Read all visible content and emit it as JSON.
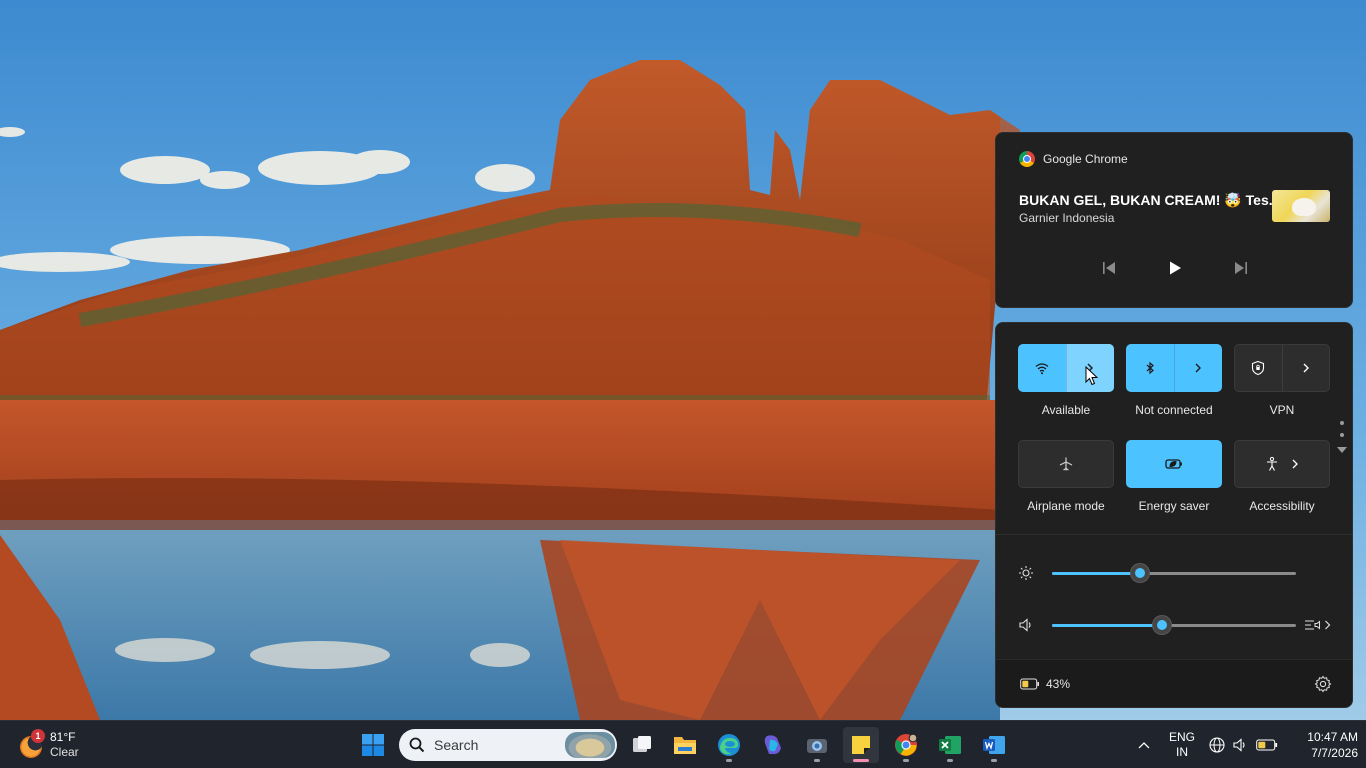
{
  "media": {
    "app_name": "Google Chrome",
    "title": "BUKAN GEL, BUKAN CREAM! 🤯 Tes...",
    "artist": "Garnier Indonesia",
    "controls": {
      "previous": "previous-icon",
      "play": "play-icon",
      "next": "next-icon"
    }
  },
  "quick_settings": {
    "tiles": [
      {
        "id": "wifi",
        "label": "Available",
        "icon": "wifi-icon",
        "state": "on",
        "expandable": true
      },
      {
        "id": "bluetooth",
        "label": "Not connected",
        "icon": "bluetooth-icon",
        "state": "on",
        "expandable": true
      },
      {
        "id": "vpn",
        "label": "VPN",
        "icon": "vpn-shield-icon",
        "state": "off",
        "expandable": true
      },
      {
        "id": "airplane",
        "label": "Airplane mode",
        "icon": "airplane-icon",
        "state": "off",
        "expandable": false
      },
      {
        "id": "energy_saver",
        "label": "Energy saver",
        "icon": "energy-saver-icon",
        "state": "on",
        "expandable": false
      },
      {
        "id": "accessibility",
        "label": "Accessibility",
        "icon": "accessibility-icon",
        "state": "off",
        "expandable": true
      }
    ],
    "brightness": {
      "icon": "brightness-icon",
      "level_fraction": 0.36
    },
    "volume": {
      "icon": "speaker-icon",
      "level_fraction": 0.45
    },
    "battery": {
      "icon": "battery-icon",
      "percent_text": "43%"
    },
    "accent_color": "#4cc2ff"
  },
  "taskbar": {
    "weather": {
      "temperature": "81°F",
      "condition": "Clear",
      "badge_count": "1"
    },
    "search_placeholder": "Search",
    "pinned_apps": [
      "start-icon",
      "task-view-icon",
      "file-explorer-icon",
      "edge-icon",
      "copilot-icon",
      "camera-app-icon",
      "sticky-notes-icon",
      "chrome-icon",
      "excel-icon",
      "word-icon"
    ],
    "language": {
      "line1": "ENG",
      "line2": "IN"
    },
    "tray_icons": [
      "globe-icon",
      "volume-icon",
      "battery-icon"
    ],
    "clock": {
      "time": "10:47 AM",
      "date": "7/7/2026"
    }
  }
}
